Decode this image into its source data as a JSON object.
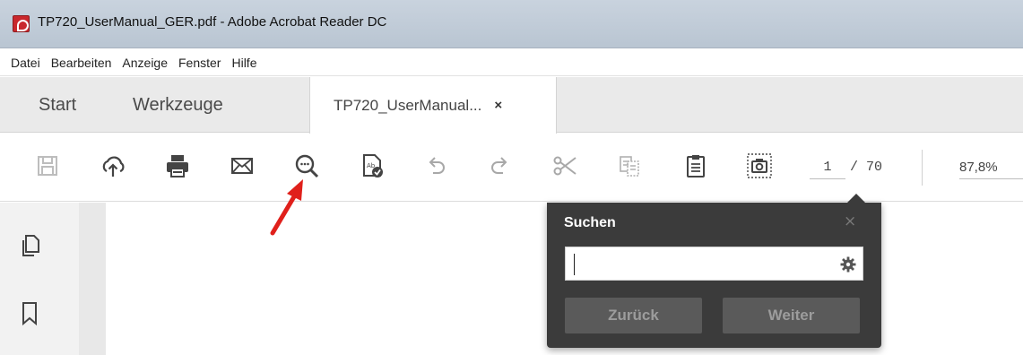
{
  "window": {
    "title": "TP720_UserManual_GER.pdf - Adobe Acrobat Reader DC"
  },
  "menu": [
    "Datei",
    "Bearbeiten",
    "Anzeige",
    "Fenster",
    "Hilfe"
  ],
  "tabs": {
    "start": "Start",
    "tools": "Werkzeuge",
    "document": "TP720_UserManual...",
    "close_glyph": "×"
  },
  "toolbar": {
    "icons": [
      "save-icon",
      "upload-cloud-icon",
      "print-icon",
      "mail-icon",
      "search-zoom-icon",
      "fill-sign-icon",
      "undo-icon",
      "redo-icon",
      "cut-icon",
      "copy-icon",
      "clipboard-icon",
      "snapshot-icon"
    ],
    "page_current": "1",
    "page_total": "/ 70",
    "zoom": "87,8%"
  },
  "search_panel": {
    "title": "Suchen",
    "close_glyph": "×",
    "input_value": "",
    "back_label": "Zurück",
    "next_label": "Weiter"
  },
  "colors": {
    "accent_red": "#e0201b",
    "panel_bg": "#3b3b3b",
    "button_bg": "#5a5a5a"
  }
}
